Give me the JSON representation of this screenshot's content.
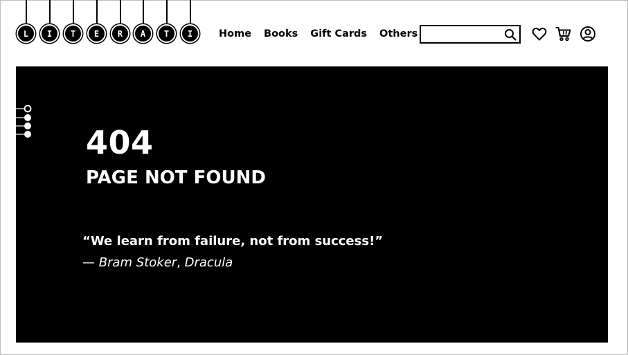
{
  "brand": {
    "letters": [
      "L",
      "I",
      "T",
      "E",
      "R",
      "A",
      "T",
      "I"
    ]
  },
  "nav": {
    "items": [
      {
        "label": "Home"
      },
      {
        "label": "Books"
      },
      {
        "label": "Gift Cards"
      },
      {
        "label": "Others"
      }
    ]
  },
  "search": {
    "value": "",
    "placeholder": ""
  },
  "icons": {
    "search": "search-icon",
    "wishlist": "heart-icon",
    "cart": "cart-icon",
    "account": "user-icon"
  },
  "error": {
    "code": "404",
    "message": "PAGE NOT FOUND",
    "quote": "“We learn from failure, not from success!”",
    "dash": "— ",
    "author": "Bram Stoker",
    "separator": ", ",
    "work": "Dracula"
  },
  "colors": {
    "panel_background": "#000000",
    "page_background": "#ffffff",
    "text_on_panel": "#ffffff"
  }
}
